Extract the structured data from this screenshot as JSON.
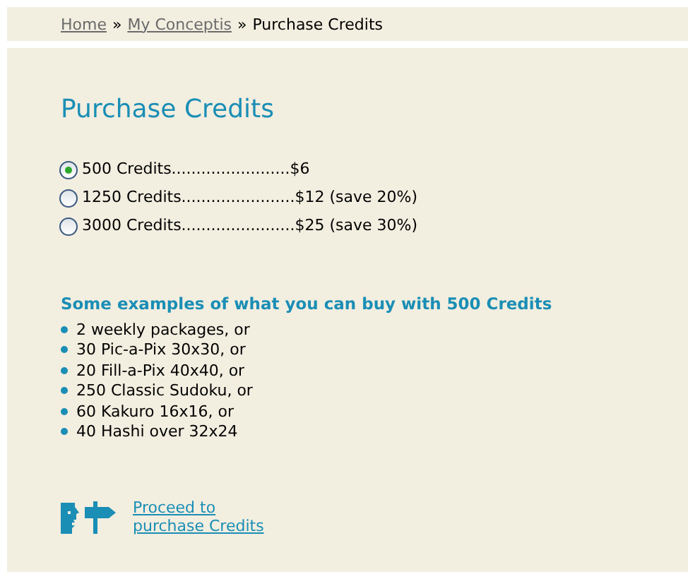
{
  "breadcrumb": {
    "links": [
      "Home",
      "My Conceptis"
    ],
    "separator": "»",
    "current": "Purchase Credits"
  },
  "title": "Purchase Credits",
  "options": [
    {
      "label": "500 Credits........................$6",
      "selected": true
    },
    {
      "label": "1250 Credits.......................$12 (save 20%)",
      "selected": false
    },
    {
      "label": "3000 Credits.......................$25 (save 30%)",
      "selected": false
    }
  ],
  "examples": {
    "heading": "Some examples of what you can buy with 500 Credits",
    "items": [
      "2 weekly packages, or",
      "30 Pic-a-Pix 30x30, or",
      "20 Fill-a-Pix 40x40, or",
      "250 Classic Sudoku, or",
      "60 Kakuro 16x16, or",
      "40 Hashi over 32x24"
    ]
  },
  "proceed": {
    "line1": "Proceed to",
    "line2": "purchase Credits"
  }
}
